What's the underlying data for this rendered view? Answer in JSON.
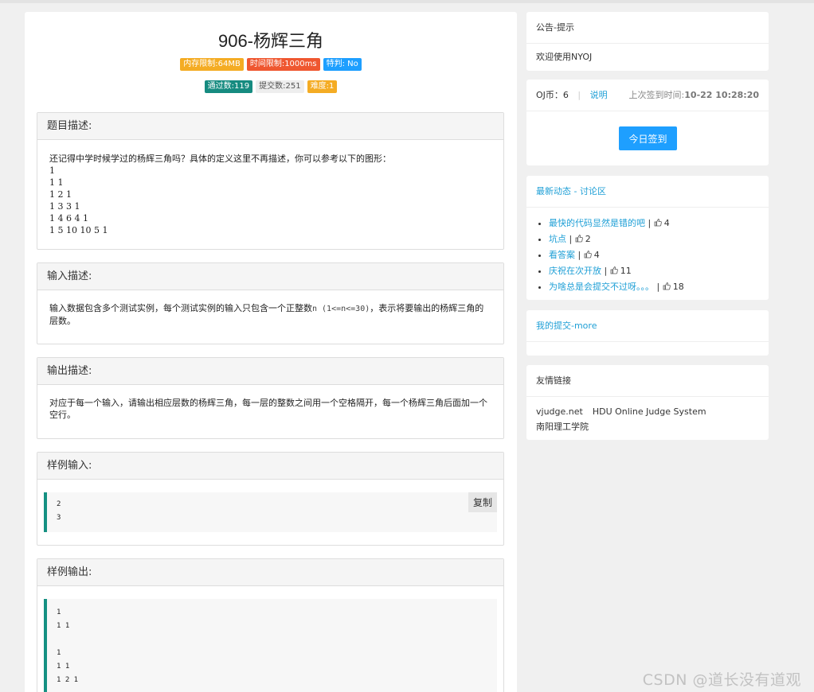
{
  "problem": {
    "title": "906-杨辉三角",
    "badges_row1": [
      {
        "text": "内存限制:64MB",
        "color": "#f4ac24"
      },
      {
        "text": "时间限制:1000ms",
        "color": "#ef5730"
      },
      {
        "text": "特判: No",
        "color": "#1e9fff"
      }
    ],
    "badges_row2": [
      {
        "text": "通过数:119",
        "color": "#168b80"
      },
      {
        "text": "提交数:251",
        "color": "#eeeeee",
        "text_color": "#555"
      },
      {
        "text": "难度:1",
        "color": "#f4ac24"
      }
    ],
    "description": {
      "heading": "题目描述:",
      "intro": "还记得中学时候学过的杨辉三角吗？具体的定义这里不再描述，你可以参考以下的图形：",
      "lines": [
        "1",
        "1 1",
        "1 2 1",
        "1 3 3 1",
        "1 4 6 4 1",
        "1 5 10 10 5 1"
      ]
    },
    "input": {
      "heading": "输入描述:",
      "text_before": "输入数据包含多个测试实例，每个测试实例的输入只包含一个正整数",
      "code": "n (1<=n<=30)",
      "text_after": "，表示将要输出的杨辉三角的层数。"
    },
    "output": {
      "heading": "输出描述:",
      "text": "对应于每一个输入，请输出相应层数的杨辉三角，每一层的整数之间用一个空格隔开，每一个杨辉三角后面加一个空行。"
    },
    "sample_input": {
      "heading": "样例输入:",
      "copy_label": "复制",
      "lines": [
        "2",
        "3"
      ]
    },
    "sample_output": {
      "heading": "样例输出:",
      "lines": [
        "1",
        "1 1",
        "",
        "1",
        "1 1",
        "1 2 1"
      ]
    }
  },
  "sidebar": {
    "notice": {
      "title": "公告-提示",
      "body": "欢迎使用NYOJ"
    },
    "coins": {
      "label": "OJ币：",
      "value": "6",
      "explain_link": "说明",
      "last_sign_label": "上次签到时间:",
      "last_sign_value": "10-22 10:28:20",
      "sign_button": "今日签到"
    },
    "news": {
      "title": "最新动态 - 讨论区",
      "items": [
        {
          "title": "最快的代码显然是错的吧",
          "likes": "4"
        },
        {
          "title": "坑点",
          "likes": "2"
        },
        {
          "title": "看答案",
          "likes": "4"
        },
        {
          "title": "庆祝在次开放",
          "likes": "11"
        },
        {
          "title": "为啥总是会提交不过呀。。。",
          "likes": "18"
        }
      ]
    },
    "submissions": {
      "title": "我的提交-more"
    },
    "links": {
      "title": "友情链接",
      "row1": [
        "vjudge.net",
        "HDU Online Judge System"
      ],
      "row2": [
        "南阳理工学院"
      ]
    }
  },
  "watermark": "CSDN @道长没有道观"
}
